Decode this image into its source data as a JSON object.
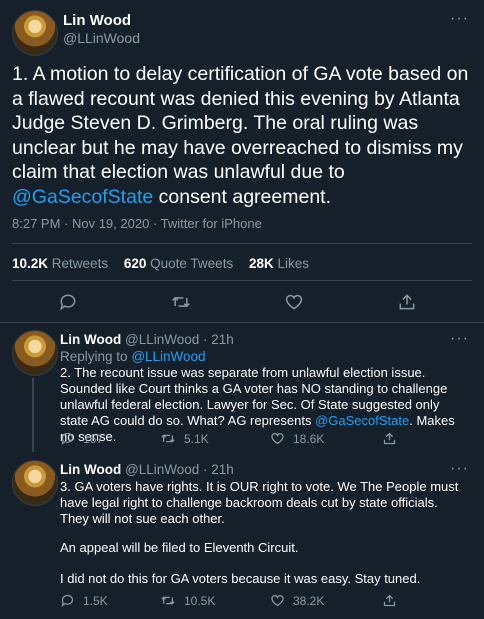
{
  "main": {
    "author": "Lin Wood",
    "handle": "@LLinWood",
    "text_before_mention": "1. A motion to delay certification of GA vote based on a flawed recount was denied this evening by Atlanta Judge Steven D. Grimberg. The oral ruling was unclear but he may have overreached to dismiss my claim that election was unlawful due to ",
    "mention": "@GaSecofState",
    "text_after_mention": " consent agreement.",
    "time": "8:27 PM · Nov 19, 2020",
    "source": "Twitter for iPhone",
    "retweets_count": "10.2K",
    "retweets_label": "Retweets",
    "quotes_count": "620",
    "quotes_label": "Quote Tweets",
    "likes_count": "28K",
    "likes_label": "Likes"
  },
  "reply1": {
    "author": "Lin Wood",
    "handle": "@LLinWood",
    "age": "21h",
    "replying_prefix": "Replying to",
    "replying_to": "@LLinWood",
    "text_before_mention": "2. The recount issue was separate from unlawful election issue. Sounded like Court thinks a GA voter has NO standing to challenge unlawful federal election. Lawyer for Sec. Of State suggested only state AG could do so. What? AG represents ",
    "mention": "@GaSecofState",
    "text_after_mention": ". Makes no sense.",
    "replies": "167",
    "retweets": "5.1K",
    "likes": "18.6K"
  },
  "reply2": {
    "author": "Lin Wood",
    "handle": "@LLinWood",
    "age": "21h",
    "para1": "3. GA voters have rights. It is OUR right to vote. We The People must have legal right to challenge backroom deals cut by state officials. They will not sue each other.",
    "para2": "An appeal will be filed to Eleventh Circuit.",
    "para3": "I did not do this for GA voters because it was easy. Stay tuned.",
    "replies": "1.5K",
    "retweets": "10.5K",
    "likes": "38.2K"
  },
  "icons": [
    "more-icon",
    "reply-icon",
    "retweet-icon",
    "like-icon",
    "share-icon"
  ],
  "colors": {
    "background": "#15202b",
    "accent": "#1da1f2",
    "muted": "#8899a6",
    "border": "#38444d"
  }
}
